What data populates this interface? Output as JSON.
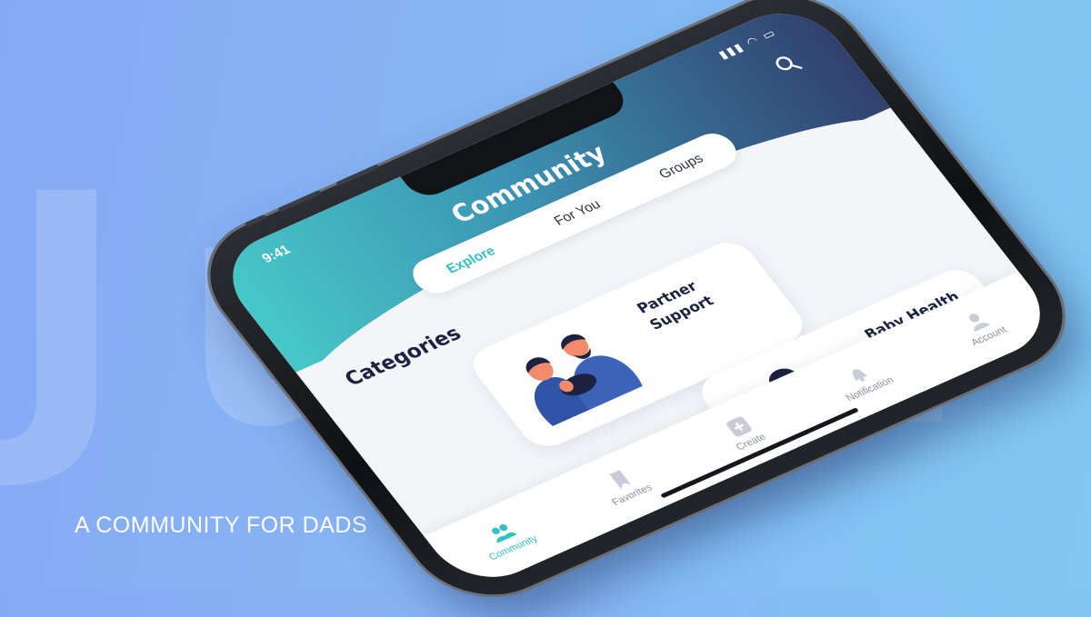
{
  "background": {
    "word": "Junu",
    "tagline": "A COMMUNITY FOR DADS"
  },
  "status_bar": {
    "time": "9:41"
  },
  "header": {
    "title": "Community",
    "tabs": [
      {
        "label": "Explore",
        "active": true
      },
      {
        "label": "For You",
        "active": false
      },
      {
        "label": "Groups",
        "active": false
      }
    ]
  },
  "main": {
    "section_title": "Categories",
    "cards": [
      {
        "label": "Partner\nSupport",
        "illustration": "couple-hugging-baby"
      },
      {
        "label": "Baby Health\n& Care",
        "illustration": "dad-holding-baby"
      }
    ]
  },
  "bottom_nav": [
    {
      "label": "Community",
      "icon": "people-icon",
      "active": true
    },
    {
      "label": "Favorites",
      "icon": "bookmark-icon",
      "active": false
    },
    {
      "label": "Create",
      "icon": "plus-icon",
      "active": false
    },
    {
      "label": "Notification",
      "icon": "bell-icon",
      "active": false
    },
    {
      "label": "Account",
      "icon": "person-icon",
      "active": false
    }
  ],
  "colors": {
    "accent": "#2fc1c3",
    "header_start": "#47c7c8",
    "header_end": "#31406e",
    "text_dark": "#1c2240",
    "illustration_blue": "#2f53a6"
  }
}
